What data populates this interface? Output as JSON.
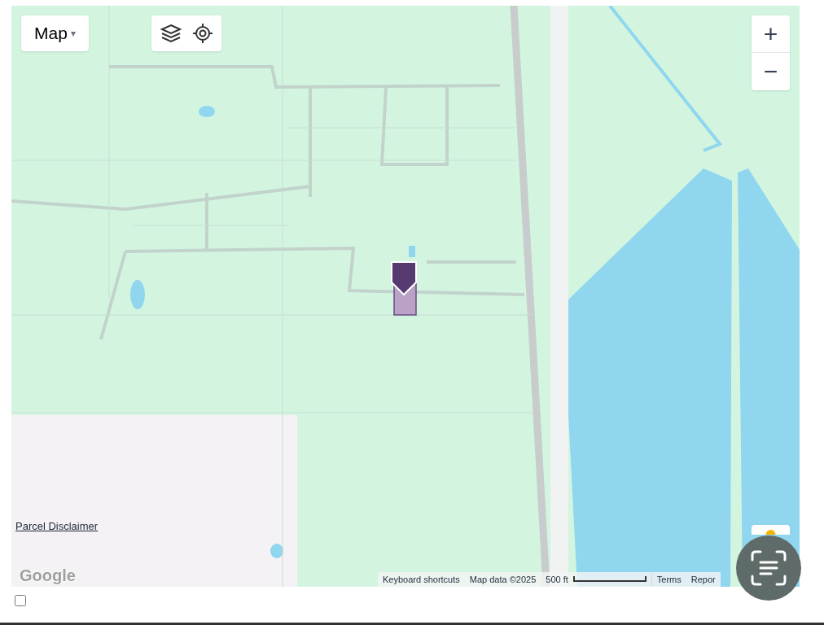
{
  "map": {
    "map_type_button": {
      "label": "Map",
      "caret": "▾"
    },
    "zoom_buttons": [
      "+",
      "−"
    ],
    "parcel_disclaimer": "Parcel Disclaimer",
    "logo": "Google",
    "footer": {
      "keyboard_shortcuts": "Keyboard shortcuts",
      "map_data": "Map data ©2025",
      "scale": "500 ft",
      "terms": "Terms",
      "report": "Repor"
    }
  },
  "checkbox": {
    "checked": false
  }
}
